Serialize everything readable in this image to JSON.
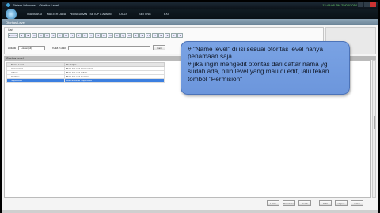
{
  "window": {
    "title": "Sistem Informasi - Otoritas Level",
    "clock": "12:45:08 PM 25/04/2014"
  },
  "menu": [
    "TRANSAKSI",
    "MASTER DATA",
    "PERSEDIAAN",
    "SETUP & ADMIN",
    "TOOLS",
    "SETTING",
    "EXIT"
  ],
  "header": {
    "title": "Otoritas Level"
  },
  "cari": {
    "legend": "Cari",
    "letters": [
      "Semua",
      "A",
      "B",
      "C",
      "D",
      "E",
      "F",
      "G",
      "H",
      "I",
      "J",
      "K",
      "L",
      "M",
      "N",
      "O",
      "P",
      "Q",
      "R",
      "S",
      "T",
      "U",
      "V",
      "W",
      "X",
      "Y",
      "Z"
    ],
    "field_label": "Lokasi",
    "select_value": "Lokasi(All)",
    "text_label": "Kata Kunci",
    "button": "Cari"
  },
  "list": {
    "title": "Otoritas Level",
    "columns": [
      "Nama Level",
      "Deskripsi"
    ],
    "rows": [
      {
        "name": "Accountant",
        "desc": "Built-in Level Accountant",
        "selected": false
      },
      {
        "name": "Admin",
        "desc": "Built-in Level Admin",
        "selected": false
      },
      {
        "name": "Cashier",
        "desc": "Built-in Level Cashier",
        "selected": false
      },
      {
        "name": "Supervisor",
        "desc": "Built-in Level Supervisor",
        "selected": true
      }
    ]
  },
  "tooltip": {
    "text": "# \"Name level\" di isi sesuai otoritas level hanya penamaan saja\n# jika ingin mengedit otoritas dari daftar nama yg sudah ada, pilih level yang mau di edit, lalu tekan tombol \"Permision\""
  },
  "buttons": [
    "Latak",
    "Permission",
    "Cetak",
    "Edit",
    "Hapus",
    "Tutup"
  ]
}
